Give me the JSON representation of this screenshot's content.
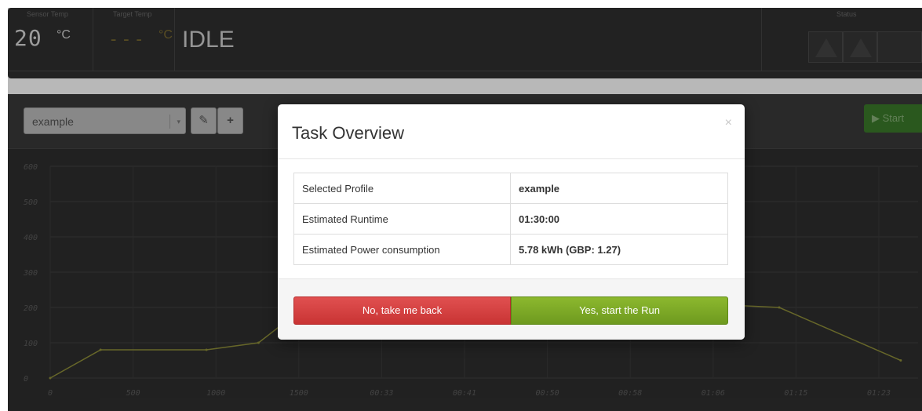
{
  "header": {
    "sensor_temp_label": "Sensor Temp",
    "target_temp_label": "Target Temp",
    "status_label": "Status",
    "sensor_temp_value": "20",
    "sensor_temp_unit": "°C",
    "target_temp_value": "---",
    "target_temp_unit": "°C",
    "state": "IDLE"
  },
  "toolbar": {
    "profile_selected": "example",
    "edit_icon": "edit-icon",
    "add_icon": "plus-icon",
    "start_label": "Start",
    "start_icon": "play-icon"
  },
  "chart_data": {
    "type": "line",
    "x_ticks": [
      "0",
      "500",
      "1000",
      "1500",
      "00:33",
      "00:41",
      "00:50",
      "00:58",
      "01:06",
      "01:15",
      "01:23"
    ],
    "y_ticks": [
      "0",
      "100",
      "200",
      "300",
      "400",
      "500",
      "600"
    ],
    "ylim": [
      0,
      600
    ],
    "grid": true,
    "series": [
      {
        "color": "#8f8f3a",
        "points": [
          [
            0,
            0
          ],
          [
            290,
            80
          ],
          [
            900,
            80
          ],
          [
            1200,
            100
          ],
          [
            1620,
            260
          ],
          [
            4200,
            200
          ],
          [
            4900,
            50
          ]
        ]
      }
    ]
  },
  "modal": {
    "title": "Task Overview",
    "close_glyph": "×",
    "rows": [
      {
        "key": "Selected Profile",
        "value": "example"
      },
      {
        "key": "Estimated Runtime",
        "value": "01:30:00"
      },
      {
        "key": "Estimated Power consumption",
        "value": "5.78 kWh (GBP: 1.27)"
      }
    ],
    "cancel_label": "No, take me back",
    "confirm_label": "Yes, start the Run"
  }
}
